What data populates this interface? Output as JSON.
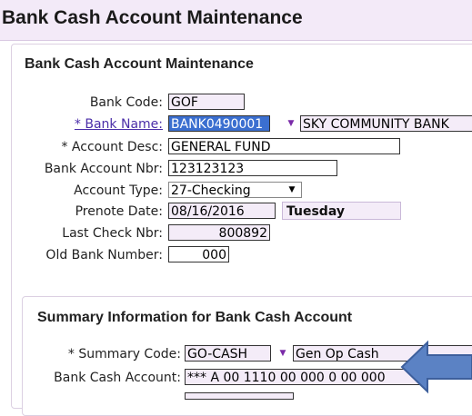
{
  "header": {
    "title": "Bank Cash Account Maintenance"
  },
  "section": {
    "title": "Bank Cash Account Maintenance"
  },
  "fields": {
    "bank_code": {
      "label": "Bank Code:",
      "value": "GOF"
    },
    "bank_name": {
      "label": "* Bank Name:",
      "value": "BANK0490001",
      "description": "SKY COMMUNITY BANK"
    },
    "account_desc": {
      "label": "* Account Desc:",
      "value": "GENERAL FUND"
    },
    "bank_account_nbr": {
      "label": "Bank Account Nbr:",
      "value": "123123123"
    },
    "account_type": {
      "label": "Account Type:",
      "value": "27-Checking"
    },
    "prenote_date": {
      "label": "Prenote Date:",
      "value": "08/16/2016",
      "day": "Tuesday"
    },
    "last_check_nbr": {
      "label": "Last Check Nbr:",
      "value": "800892"
    },
    "old_bank_number": {
      "label": "Old Bank Number:",
      "value": "000"
    }
  },
  "summary": {
    "title": "Summary Information for Bank Cash Account",
    "summary_code": {
      "label": "* Summary Code:",
      "value": "GO-CASH",
      "description": "Gen Op Cash"
    },
    "bank_cash_account": {
      "label": "Bank Cash Account:",
      "value": "*** A 00 1110 00 000 0 00 000"
    }
  },
  "icons": {
    "dropdown": "chevron-down-icon",
    "arrow": "arrow-left-icon"
  },
  "colors": {
    "header_bg": "#f3eaf8",
    "selection": "#3b6fd0",
    "link": "#4b2ea8",
    "arrow": "#5b82c4"
  }
}
